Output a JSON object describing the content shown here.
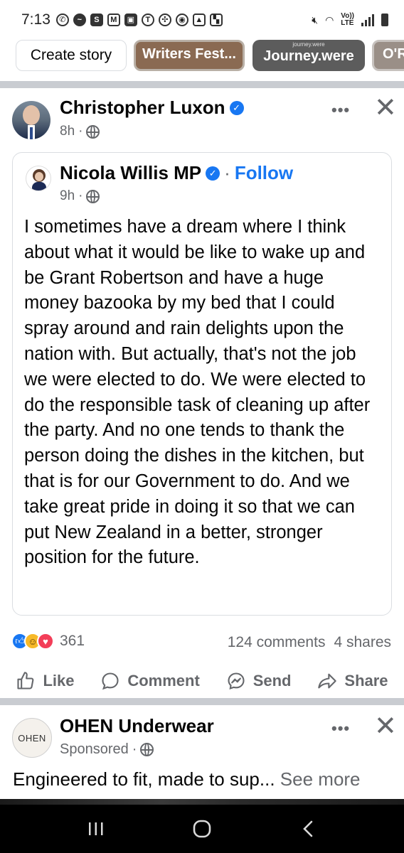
{
  "status_bar": {
    "time": "7:13",
    "volte_label": "Vo))",
    "lte_label": "LTE"
  },
  "stories": {
    "create_label": "Create story",
    "cards": [
      {
        "label": "Writers Fest...",
        "sublabel": ""
      },
      {
        "label": "Journey.were",
        "sublabel": "journey.were"
      },
      {
        "label": "O'R",
        "sublabel": ""
      }
    ]
  },
  "post": {
    "author": "Christopher Luxon",
    "time": "8h",
    "shared": {
      "author": "Nicola Willis MP",
      "follow_label": "Follow",
      "separator": "·",
      "time": "9h",
      "text": "I sometimes have a dream where I think about what it would be like to wake up and be Grant Robertson and have a huge money bazooka by my bed that I could spray around and rain delights upon the nation with. But actually, that's not the job we were elected to do. We were elected to do the responsible task of cleaning up after the party. And no one tends to thank the person doing the dishes in the kitchen, but that is for our Government to do. And we take great pride in doing it so that we can put New Zealand in a better, stronger position for the future."
    },
    "reactions_count": "361",
    "comments": "124 comments",
    "shares": "4 shares",
    "actions": {
      "like": "Like",
      "comment": "Comment",
      "send": "Send",
      "share": "Share"
    }
  },
  "sponsored": {
    "author": "OHEN Underwear",
    "avatar_text": "OHEN",
    "label": "Sponsored",
    "text": "Engineered to fit, made to sup...",
    "see_more": "See more"
  },
  "colors": {
    "accent": "#1877f2",
    "secondary_text": "#65676b",
    "divider": "#c9ccd1"
  },
  "icons": [
    "whatsapp-icon",
    "messenger-icon",
    "verified-icon",
    "globe-icon",
    "more-icon",
    "close-icon",
    "like-icon",
    "comment-icon",
    "send-icon",
    "share-icon",
    "recents-icon",
    "home-icon",
    "back-icon"
  ]
}
